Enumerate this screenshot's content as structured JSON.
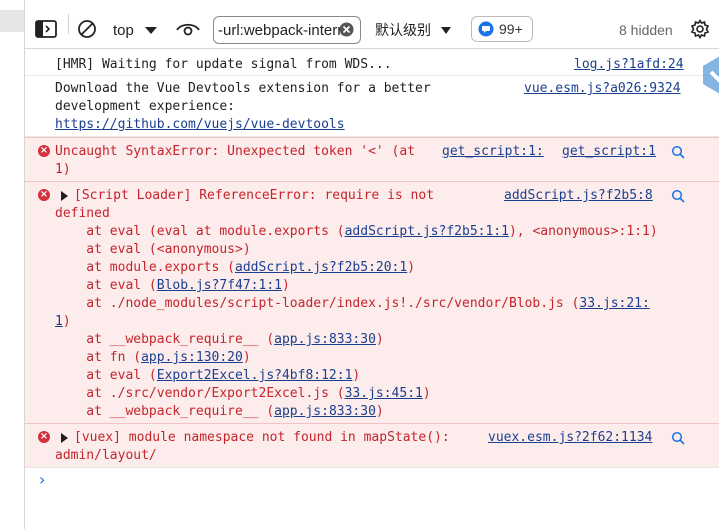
{
  "toolbar": {
    "context": "top",
    "filter_value": "-url:webpack-intern",
    "level_label": "默认级别",
    "issues_count": "99+",
    "hidden_text": "8 hidden"
  },
  "messages": {
    "hmr_text": "[HMR] Waiting for update signal from WDS...",
    "hmr_source": "log.js?1afd:24",
    "devtools_line1": "Download the Vue Devtools extension for a better",
    "devtools_line2": "development experience:",
    "devtools_link": "https://github.com/vuejs/vue-devtools",
    "devtools_source": "vue.esm.js?a026:9324",
    "syntax_prefix": "Uncaught SyntaxError: Unexpected token '<' (at ",
    "syntax_link": "get_script:1:",
    "syntax_cont": "1)",
    "syntax_source": "get_script:1",
    "script_loader_line1": "[Script Loader] ReferenceError: require is not",
    "script_loader_line2": "defined",
    "script_loader_source": "addScript.js?f2b5:8",
    "stack1_a": "    at eval (eval at module.exports (",
    "stack1_link": "addScript.js?f2b5:1:1",
    "stack1_b": "), <anonymous>:1:1)",
    "stack2": "    at eval (<anonymous>)",
    "stack3_a": "    at module.exports (",
    "stack3_link": "addScript.js?f2b5:20:1",
    "stack3_b": ")",
    "stack4_a": "    at eval (",
    "stack4_link": "Blob.js?7f47:1:1",
    "stack4_b": ")",
    "stack5_a": "    at ./node_modules/script-loader/index.js!./src/vendor/Blob.js (",
    "stack5_link": "33.js:21:",
    "stack5_cont": "1",
    "stack5_b": ")",
    "stack6_a": "    at __webpack_require__ (",
    "stack6_link": "app.js:833:30",
    "stack6_b": ")",
    "stack7_a": "    at fn (",
    "stack7_link": "app.js:130:20",
    "stack7_b": ")",
    "stack8_a": "    at eval (",
    "stack8_link": "Export2Excel.js?4bf8:12:1",
    "stack8_b": ")",
    "stack9_a": "    at ./src/vendor/Export2Excel.js (",
    "stack9_link": "33.js:45:1",
    "stack9_b": ")",
    "stack10_a": "    at __webpack_require__ (",
    "stack10_link": "app.js:833:30",
    "stack10_b": ")",
    "vuex_line1": "[vuex] module namespace not found in mapState():",
    "vuex_line2": "admin/layout/",
    "vuex_source": "vuex.esm.js?2f62:1134"
  },
  "prompt_symbol": "›",
  "colors": {
    "error_bg": "#fdecec",
    "error_text": "#c4252c",
    "link": "#1b3f8f"
  }
}
